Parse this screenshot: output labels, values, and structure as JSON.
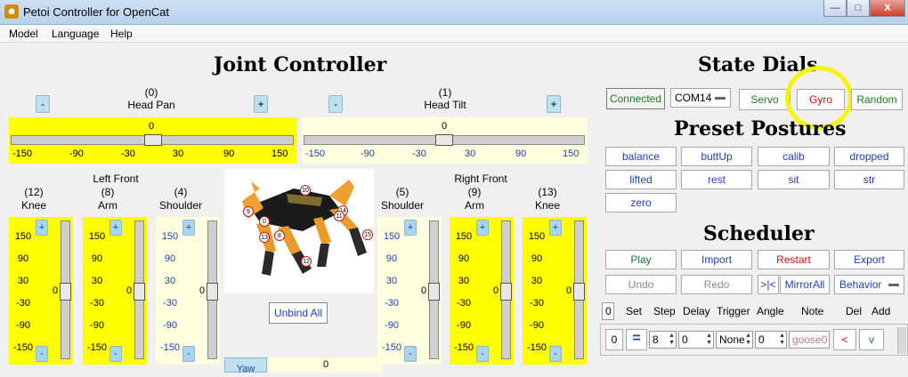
{
  "window": {
    "title": "Petoi Controller for OpenCat",
    "icon": "cat-logo-icon",
    "min_label": "—",
    "max_label": "□",
    "close_label": "X"
  },
  "menu": [
    "Model",
    "Language",
    "Help"
  ],
  "joint_controller": {
    "title": "Joint Controller",
    "head_pan": {
      "index": "(0)",
      "name": "Head Pan",
      "value": "0",
      "ticks": [
        "-150",
        "-90",
        "-30",
        "30",
        "90",
        "150"
      ]
    },
    "head_tilt": {
      "index": "(1)",
      "name": "Head Tilt",
      "value": "0",
      "ticks": [
        "-150",
        "-90",
        "-30",
        "30",
        "90",
        "150"
      ]
    },
    "minus": "-",
    "plus": "+",
    "left_front": "Left Front",
    "right_front": "Right Front",
    "vertical_ticks": [
      "150",
      "90",
      "30",
      "-30",
      "-90",
      "-150"
    ],
    "joints": [
      {
        "index": "(12)",
        "name": "Knee",
        "value": "0"
      },
      {
        "index": "(8)",
        "name": "Arm",
        "value": "0"
      },
      {
        "index": "(4)",
        "name": "Shoulder",
        "value": "0"
      },
      {
        "index": "(5)",
        "name": "Shoulder",
        "value": "0"
      },
      {
        "index": "(9)",
        "name": "Arm",
        "value": "0"
      },
      {
        "index": "(13)",
        "name": "Knee",
        "value": "0"
      }
    ],
    "unbind_all": "Unbind All",
    "yaw_label": "Yaw",
    "yaw_value": "0",
    "robot_joint_markers": [
      "10",
      "9",
      "14",
      "0",
      "11",
      "13",
      "8",
      "15",
      "12"
    ]
  },
  "state_dials": {
    "title": "State Dials",
    "connected": "Connected",
    "port": "COM14",
    "servo": "Servo",
    "gyro": "Gyro",
    "random": "Random"
  },
  "preset_postures": {
    "title": "Preset Postures",
    "buttons": [
      "balance",
      "buttUp",
      "calib",
      "dropped",
      "lifted",
      "rest",
      "sit",
      "str",
      "zero"
    ]
  },
  "scheduler": {
    "title": "Scheduler",
    "row1": [
      "Play",
      "Import",
      "Restart",
      "Export"
    ],
    "row2": {
      "undo": "Undo",
      "redo": "Redo",
      "mirror_icon": ">|<",
      "mirror": "MirrorAll",
      "behavior": "Behavior"
    },
    "header": {
      "count": "0",
      "set": "Set",
      "step": "Step",
      "delay": "Delay",
      "trigger": "Trigger",
      "angle": "Angle",
      "note": "Note",
      "del": "Del",
      "add": "Add"
    },
    "row": {
      "index": "0",
      "set": "=",
      "step": "8",
      "delay": "0",
      "trigger": "None",
      "angle": "0",
      "note": "goose0",
      "del": "<",
      "add": "v"
    }
  },
  "colors": {
    "active_slider": "#ffff00",
    "inactive_slider": "#ffffe0",
    "highlight": "#f5f500"
  }
}
